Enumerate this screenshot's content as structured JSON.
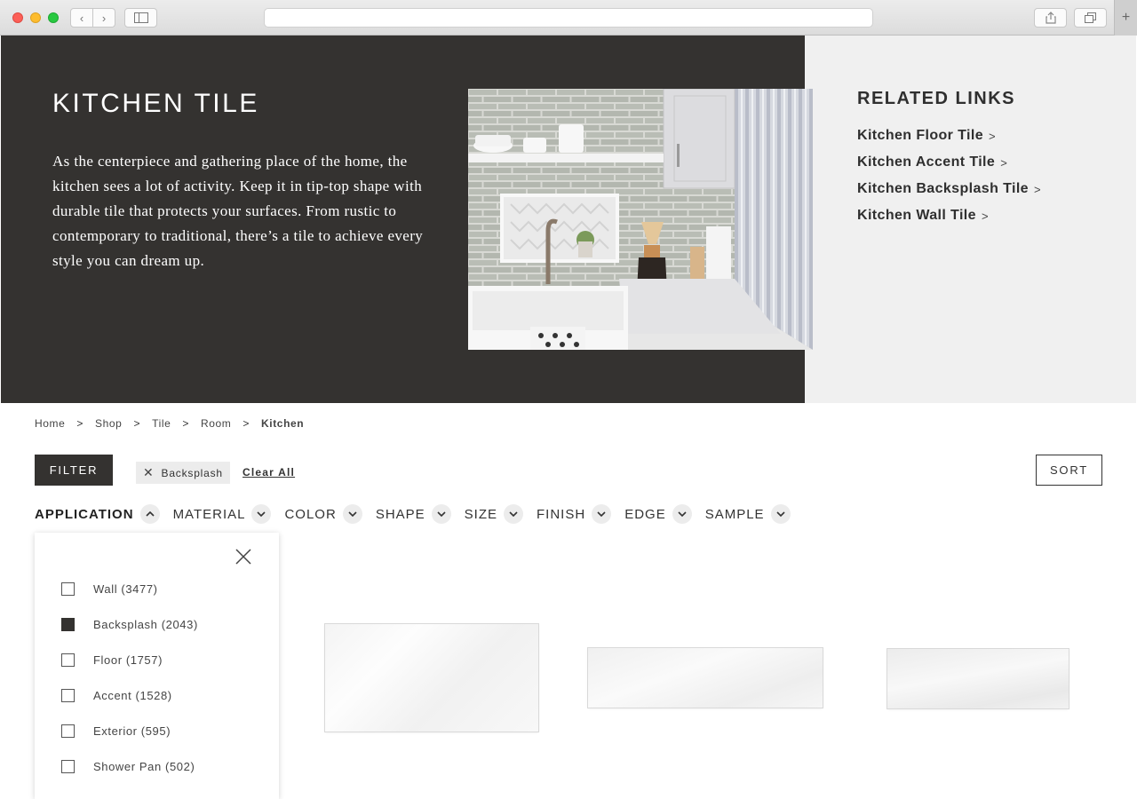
{
  "hero": {
    "title": "KITCHEN TILE",
    "description": "As the centerpiece and gathering place of the home, the kitchen sees a lot of activity. Keep it in tip-top shape with durable tile that protects your surfaces. From rustic to contemporary to traditional, there’s a tile to achieve every style you can dream up."
  },
  "related": {
    "title": "RELATED LINKS",
    "links": [
      {
        "label": "Kitchen Floor Tile",
        "arrow": ">"
      },
      {
        "label": "Kitchen Accent Tile",
        "arrow": ">"
      },
      {
        "label": "Kitchen Backsplash Tile",
        "arrow": ">"
      },
      {
        "label": "Kitchen Wall Tile",
        "arrow": ">"
      }
    ]
  },
  "breadcrumb": {
    "items": [
      "Home",
      "Shop",
      "Tile",
      "Room"
    ],
    "current": "Kitchen",
    "separator": ">"
  },
  "toolbar": {
    "filter_label": "FILTER",
    "active_chip": "Backsplash",
    "clear_all": "Clear All",
    "sort_label": "SORT"
  },
  "facets": [
    "APPLICATION",
    "MATERIAL",
    "COLOR",
    "SHAPE",
    "SIZE",
    "FINISH",
    "EDGE",
    "SAMPLE"
  ],
  "dropdown": {
    "options": [
      {
        "label": "Wall (3477)",
        "checked": false
      },
      {
        "label": "Backsplash (2043)",
        "checked": true
      },
      {
        "label": "Floor (1757)",
        "checked": false
      },
      {
        "label": "Accent (1528)",
        "checked": false
      },
      {
        "label": "Exterior (595)",
        "checked": false
      },
      {
        "label": "Shower Pan (502)",
        "checked": false
      }
    ]
  },
  "colors": {
    "hero_dark": "#343230",
    "hero_light": "#f0f0f0",
    "accent": "#343230"
  }
}
